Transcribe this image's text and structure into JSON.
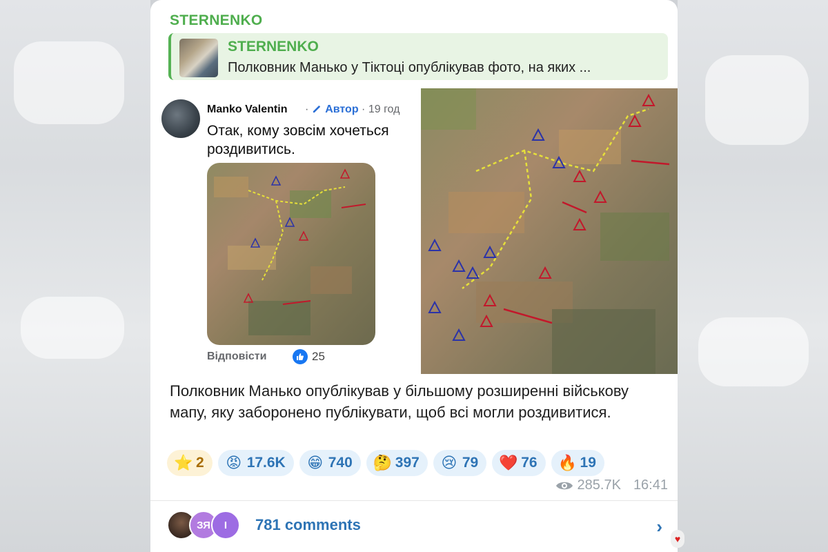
{
  "channel": {
    "name": "STERNENKO"
  },
  "reply": {
    "title": "STERNENKO",
    "text": "Полковник Манько у Тіктоці опублікував фото, на яких ..."
  },
  "fb_post": {
    "author": "Manko Valentin",
    "meta_sep": "·",
    "author_tag": "Автор",
    "time": "19 год",
    "body": "Отак, кому зовсім хочеться роздивитись.",
    "reply_label": "Відповісти",
    "like_count": "25"
  },
  "caption": "Полковник Манько опублікував у більшому розширенні військову мапу, яку заборонено публікувати, щоб всі могли роздивитися.",
  "reactions": [
    {
      "emoji": "⭐",
      "count": "2",
      "kind": "star"
    },
    {
      "emoji": "😡",
      "count": "17.6K",
      "kind": "normal"
    },
    {
      "emoji": "😁",
      "count": "740",
      "kind": "normal"
    },
    {
      "emoji": "🤔",
      "count": "397",
      "kind": "normal"
    },
    {
      "emoji": "😢",
      "count": "79",
      "kind": "normal"
    },
    {
      "emoji": "❤️",
      "count": "76",
      "kind": "normal"
    },
    {
      "emoji": "🔥",
      "count": "19",
      "kind": "normal"
    }
  ],
  "views": "285.7K",
  "time": "16:41",
  "comments": {
    "label": "781 comments",
    "avatars": [
      "",
      "ЗЯ",
      "І"
    ]
  },
  "colors": {
    "channel_green": "#4fae4e",
    "link_blue": "#2e74b5",
    "reply_bg": "#e8f4e4"
  }
}
